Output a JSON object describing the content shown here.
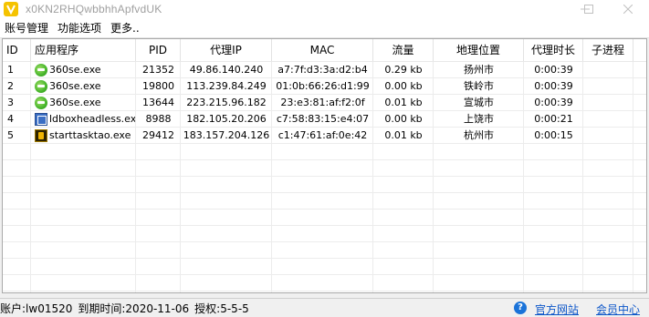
{
  "window": {
    "title": "x0KN2RHQwbbhhApfvdUK",
    "app_icon": "v-logo-icon",
    "accent": "#f5c300"
  },
  "menu": {
    "items": [
      "账号管理",
      "功能选项",
      "更多.."
    ]
  },
  "table": {
    "columns": [
      "ID",
      "应用程序",
      "PID",
      "代理IP",
      "MAC",
      "流量",
      "地理位置",
      "代理时长",
      "子进程"
    ],
    "rows": [
      {
        "id": "1",
        "app": "360se.exe",
        "icon": "ie-icon",
        "pid": "21352",
        "ip": "49.86.140.240",
        "mac": "a7:7f:d3:3a:d2:b4",
        "traffic": "0.29 kb",
        "location": "扬州市",
        "duration": "0:00:39",
        "child": ""
      },
      {
        "id": "2",
        "app": "360se.exe",
        "icon": "ie-icon",
        "pid": "19800",
        "ip": "113.239.84.249",
        "mac": "01:0b:66:26:d1:99",
        "traffic": "0.00 kb",
        "location": "铁岭市",
        "duration": "0:00:39",
        "child": ""
      },
      {
        "id": "3",
        "app": "360se.exe",
        "icon": "ie-icon",
        "pid": "13644",
        "ip": "223.215.96.182",
        "mac": "23:e3:81:af:f2:0f",
        "traffic": "0.01 kb",
        "location": "宣城市",
        "duration": "0:00:39",
        "child": ""
      },
      {
        "id": "4",
        "app": "ldboxheadless.exe",
        "icon": "ldbox-icon",
        "pid": "8988",
        "ip": "182.105.20.206",
        "mac": "c7:58:83:15:e4:07",
        "traffic": "0.00 kb",
        "location": "上饶市",
        "duration": "0:00:21",
        "child": ""
      },
      {
        "id": "5",
        "app": "starttasktao.exe",
        "icon": "starttask-icon",
        "pid": "29412",
        "ip": "183.157.204.126",
        "mac": "c1:47:61:af:0e:42",
        "traffic": "0.01 kb",
        "location": "杭州市",
        "duration": "0:00:15",
        "child": ""
      }
    ]
  },
  "status": {
    "account": "账户:lw01520",
    "expire": "到期时间:2020-11-06",
    "auth": "授权:5-5-5",
    "link_site": "官方网站",
    "link_member": "会员中心",
    "link_color": "#0b55c8"
  }
}
